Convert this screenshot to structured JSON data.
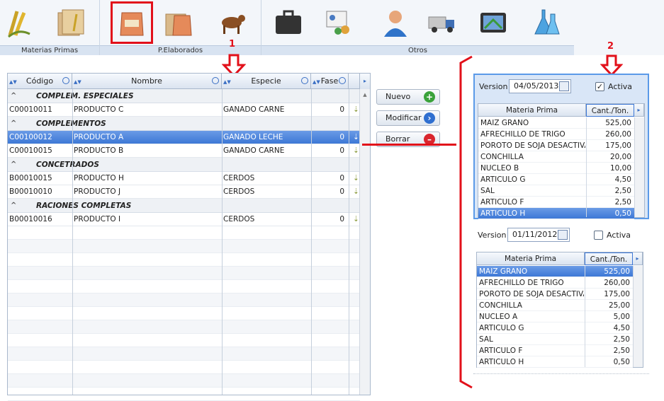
{
  "ribbon": {
    "groups": [
      {
        "label": "Materias Primas"
      },
      {
        "label": "P.Elaborados"
      },
      {
        "label": "Otros"
      }
    ],
    "icons": [
      "corn-icon",
      "folder-wheat-icon",
      "feed-bag-icon",
      "folder-bag-icon",
      "cattle-icon",
      "briefcase-icon",
      "contacts-card-icon",
      "user-icon",
      "truck-icon",
      "gps-device-icon",
      "lab-flask-icon"
    ]
  },
  "grid": {
    "columns": [
      "Código",
      "Nombre",
      "Especie",
      "Fase"
    ],
    "groups": [
      {
        "name": "COMPLEM. ESPECIALES",
        "rows": [
          {
            "codigo": "C00010011",
            "nombre": "PRODUCTO C",
            "especie": "GANADO CARNE",
            "fase": "0"
          }
        ]
      },
      {
        "name": "COMPLEMENTOS",
        "rows": [
          {
            "codigo": "C00100012",
            "nombre": "PRODUCTO A",
            "especie": "GANADO LECHE",
            "fase": "0"
          },
          {
            "codigo": "C00010015",
            "nombre": "PRODUCTO B",
            "especie": "GANADO CARNE",
            "fase": "0"
          }
        ]
      },
      {
        "name": "CONCETRADOS",
        "rows": [
          {
            "codigo": "B00010015",
            "nombre": "PRODUCTO H",
            "especie": "CERDOS",
            "fase": "0"
          },
          {
            "codigo": "B00010010",
            "nombre": "PRODUCTO J",
            "especie": "CERDOS",
            "fase": "0"
          }
        ]
      },
      {
        "name": "RACIONES COMPLETAS",
        "rows": [
          {
            "codigo": "B00010016",
            "nombre": "PRODUCTO I",
            "especie": "CERDOS",
            "fase": "0"
          }
        ]
      }
    ]
  },
  "buttons": {
    "nuevo": "Nuevo",
    "modificar": "Modificar",
    "borrar": "Borrar"
  },
  "annotations": {
    "one": "1",
    "two": "2"
  },
  "versions": [
    {
      "version_label": "Version",
      "date": "04/05/2013",
      "active_label": "Activa",
      "active": true,
      "col_materia": "Materia Prima",
      "col_cant": "Cant./Ton.",
      "rows": [
        [
          "MAIZ GRANO",
          "525,00"
        ],
        [
          "AFRECHILLO DE TRIGO",
          "260,00"
        ],
        [
          "POROTO DE SOJA DESACTIVADO",
          "175,00"
        ],
        [
          "CONCHILLA",
          "20,00"
        ],
        [
          "NUCLEO B",
          "10,00"
        ],
        [
          "ARTICULO G",
          "4,50"
        ],
        [
          "SAL",
          "2,50"
        ],
        [
          "ARTICULO F",
          "2,50"
        ],
        [
          "ARTICULO H",
          "0,50"
        ]
      ]
    },
    {
      "version_label": "Version",
      "date": "01/11/2012",
      "active_label": "Activa",
      "active": false,
      "col_materia": "Materia Prima",
      "col_cant": "Cant./Ton.",
      "rows": [
        [
          "MAIZ GRANO",
          "525,00"
        ],
        [
          "AFRECHILLO DE TRIGO",
          "260,00"
        ],
        [
          "POROTO DE SOJA DESACTIVADO",
          "175,00"
        ],
        [
          "CONCHILLA",
          "25,00"
        ],
        [
          "NUCLEO A",
          "5,00"
        ],
        [
          "ARTICULO G",
          "4,50"
        ],
        [
          "SAL",
          "2,50"
        ],
        [
          "ARTICULO F",
          "2,50"
        ],
        [
          "ARTICULO H",
          "0,50"
        ]
      ]
    }
  ],
  "colors": {
    "accent": "#3d78d6",
    "annotation": "#e2101a"
  }
}
